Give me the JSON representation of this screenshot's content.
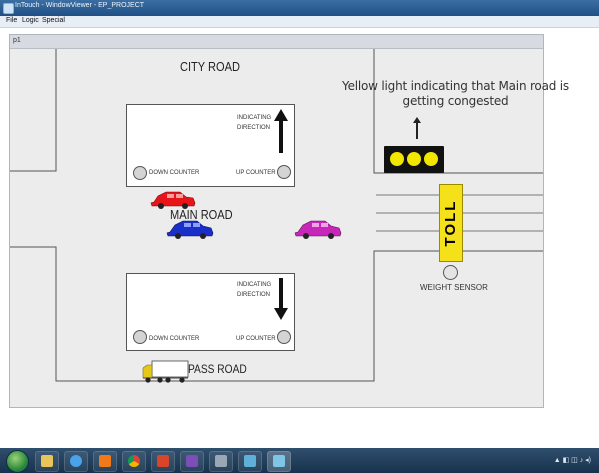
{
  "window": {
    "title": "InTouch - WindowViewer - EP_PROJECT",
    "menu": [
      "File",
      "Logic",
      "Special"
    ],
    "inner_title": "p1"
  },
  "map": {
    "city_road": "CITY ROAD",
    "main_road": "MAIN ROAD",
    "pass_road": "PASS ROAD",
    "annotation": "Yellow light indicating that Main road is getting congested",
    "toll": "TOLL",
    "weight_sensor": "WEIGHT SENSOR"
  },
  "top_counter": {
    "indicating": "INDICATING",
    "direction": "DIRECTION",
    "down_counter": "DOWN COUNTER",
    "up_counter": "UP COUNTER"
  },
  "bottom_counter": {
    "indicating": "INDICATING",
    "direction": "DIRECTION",
    "down_counter": "DOWN COUNTER",
    "up_counter": "UP COUNTER"
  },
  "colors": {
    "car_red": "#e8141a",
    "car_blue": "#1a2ec8",
    "car_magenta": "#c826b8",
    "toll": "#f5e11a",
    "light_on": "#f2e600",
    "truck": "#e5c71a"
  },
  "traffic_light_state": "yellow",
  "taskbar": {
    "apps": [
      "windows-explorer",
      "internet-explorer",
      "media-player",
      "chrome",
      "office",
      "visual-studio",
      "tools",
      "intouch-app",
      "intouch-viewer"
    ]
  }
}
